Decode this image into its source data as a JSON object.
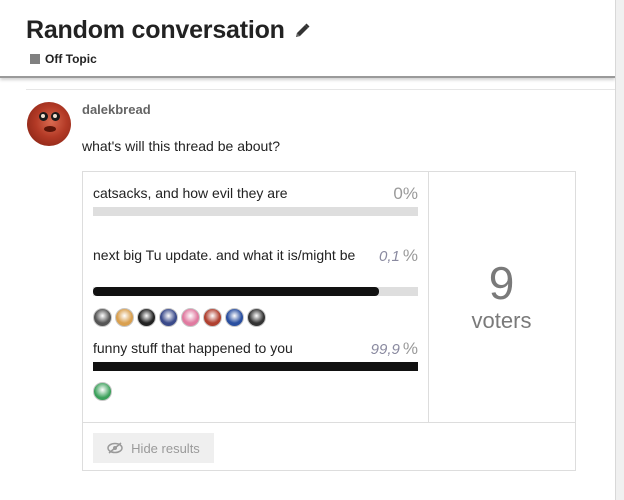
{
  "topic": {
    "title": "Random conversation",
    "category": "Off Topic",
    "category_color": "#808080"
  },
  "post": {
    "username": "dalekbread",
    "text": "what's will this thread be about?"
  },
  "poll": {
    "options": [
      {
        "label": "catsacks, and how evil they are",
        "percent_text": "0%",
        "handwritten": "",
        "value": 0
      },
      {
        "label": "next big Tu update. and what it is/might be",
        "percent_text": "%",
        "handwritten": "0,1",
        "value": 0.1
      },
      {
        "label": "funny stuff that happened to you",
        "percent_text": "%",
        "handwritten": "99,9",
        "value": 99.9
      }
    ],
    "voters_count": "9",
    "voters_label": "voters",
    "hide_results_label": "Hide results",
    "voter_avatar_colors": [
      "#555555",
      "#d9a050",
      "#222222",
      "#3a4a8a",
      "#e07aa0",
      "#b04030",
      "#2a4fa0",
      "#333333"
    ],
    "last_voter_color": "#3aa05a"
  }
}
